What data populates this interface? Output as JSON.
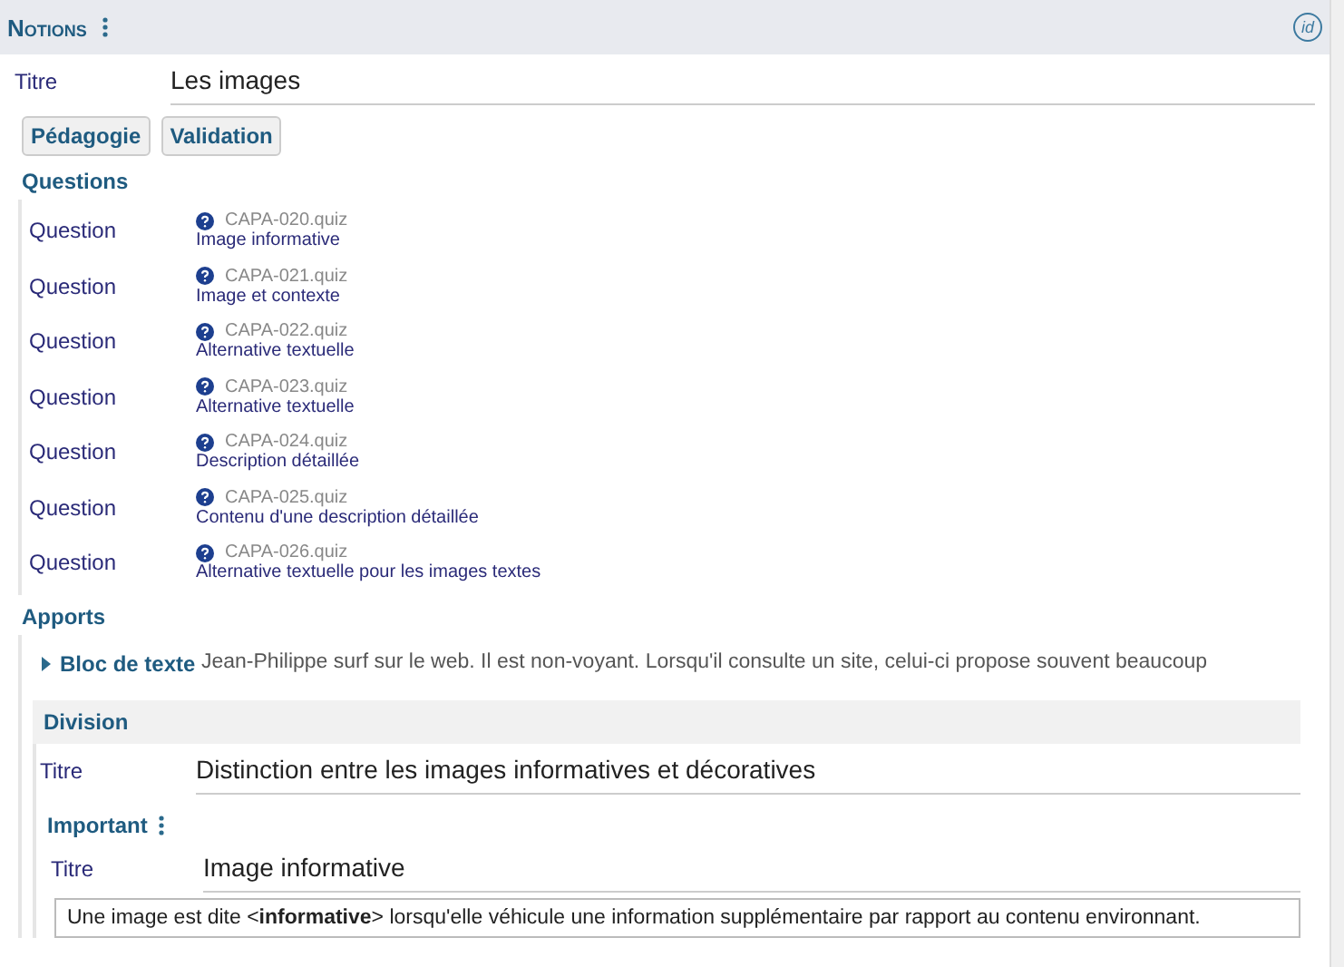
{
  "header": {
    "title": "Notions",
    "id_icon_text": "id"
  },
  "title_field": {
    "label": "Titre",
    "value": "Les images"
  },
  "buttons": [
    "Pédagogie",
    "Validation"
  ],
  "questions": {
    "heading": "Questions",
    "items": [
      {
        "label": "Question",
        "file": "CAPA-020.quiz",
        "title": "Image informative"
      },
      {
        "label": "Question",
        "file": "CAPA-021.quiz",
        "title": "Image et contexte"
      },
      {
        "label": "Question",
        "file": "CAPA-022.quiz",
        "title": "Alternative textuelle"
      },
      {
        "label": "Question",
        "file": "CAPA-023.quiz",
        "title": "Alternative textuelle"
      },
      {
        "label": "Question",
        "file": "CAPA-024.quiz",
        "title": "Description détaillée"
      },
      {
        "label": "Question",
        "file": "CAPA-025.quiz",
        "title": "Contenu d'une description détaillée"
      },
      {
        "label": "Question",
        "file": "CAPA-026.quiz",
        "title": "Alternative textuelle pour les images textes"
      }
    ]
  },
  "apports": {
    "heading": "Apports",
    "block": {
      "label": "Bloc de texte",
      "expanded": false,
      "text": "Jean-Philippe surf sur le web. Il est non-voyant. Lorsqu'il consulte un site, celui-ci propose souvent beaucoup"
    }
  },
  "division": {
    "heading": "Division",
    "title_field": {
      "label": "Titre",
      "value": "Distinction entre les images informatives et décoratives"
    },
    "important": {
      "heading": "Important",
      "title_field": {
        "label": "Titre",
        "value": "Image informative"
      },
      "paragraph": "Une image est dite <**informative**> lorsqu'elle véhicule une information supplémentaire par rapport au contenu environnant."
    }
  }
}
